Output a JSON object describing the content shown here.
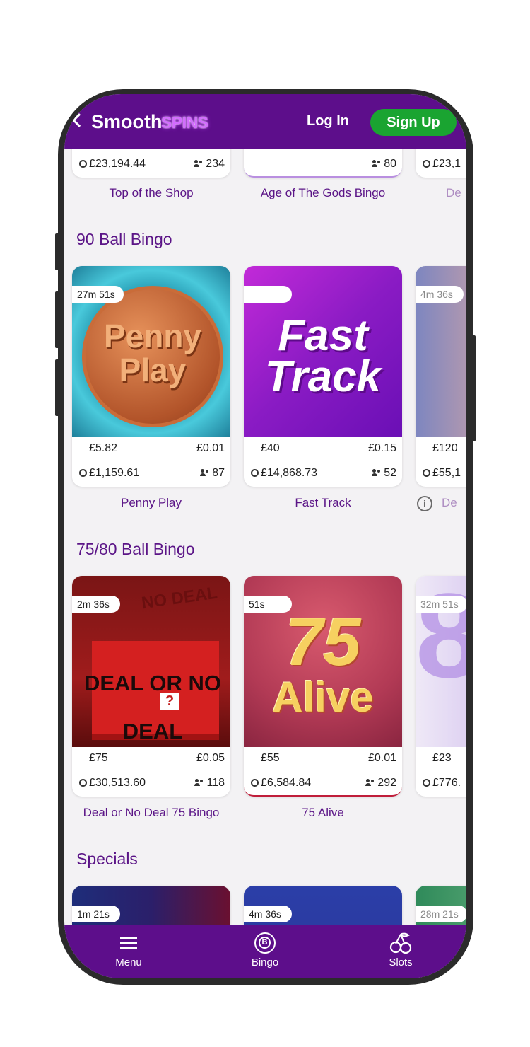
{
  "header": {
    "logo_main": "Smooth",
    "logo_accent": "SPINS",
    "login_label": "Log In",
    "signup_label": "Sign Up"
  },
  "top_row": [
    {
      "name": "Top of the Shop",
      "jackpot": "£23,194.44",
      "players": "234"
    },
    {
      "name": "Age of The Gods Bingo",
      "jackpot": "",
      "players": "80"
    },
    {
      "name": "De",
      "jackpot": "£23,1",
      "players": ""
    }
  ],
  "sections": [
    {
      "title": "90 Ball Bingo",
      "cards": [
        {
          "art_text": "Penny Play",
          "timer": "27m 51s",
          "prize": "£5.82",
          "price": "£0.01",
          "jackpot": "£1,159.61",
          "players": "87",
          "name": "Penny Play"
        },
        {
          "art_text": "Fast Track",
          "timer": "",
          "prize": "£40",
          "price": "£0.15",
          "jackpot": "£14,868.73",
          "players": "52",
          "name": "Fast Track"
        },
        {
          "art_text": "",
          "timer": "4m 36s",
          "prize": "£120",
          "price": "",
          "jackpot": "£55,1",
          "players": "",
          "name": "De"
        }
      ]
    },
    {
      "title": "75/80 Ball Bingo",
      "cards": [
        {
          "art_text": "DEAL OR NO DEAL",
          "art_q": "?",
          "art_bg_text": "NO DEAL",
          "timer": "2m 36s",
          "prize": "£75",
          "price": "£0.05",
          "jackpot": "£30,513.60",
          "players": "118",
          "name": "Deal or No Deal 75 Bingo"
        },
        {
          "art_text_top": "75",
          "art_text_bottom": "Alive",
          "timer": "51s",
          "prize": "£55",
          "price": "£0.01",
          "jackpot": "£6,584.84",
          "players": "292",
          "name": "75 Alive"
        },
        {
          "art_text": "8",
          "timer": "32m 51s",
          "prize": "£23",
          "price": "",
          "jackpot": "£776.",
          "players": "",
          "name": ""
        }
      ]
    },
    {
      "title": "Specials",
      "cards": [
        {
          "timer": "1m 21s"
        },
        {
          "timer": "4m 36s"
        },
        {
          "timer": "28m 21s"
        }
      ]
    }
  ],
  "bottom_nav": [
    {
      "label": "Menu",
      "icon": "menu-icon"
    },
    {
      "label": "Bingo",
      "icon": "bingo-ball-icon",
      "icon_letter": "B"
    },
    {
      "label": "Slots",
      "icon": "cherries-icon"
    }
  ],
  "colors": {
    "brand_purple": "#5d0e8b",
    "signup_green": "#1aa431",
    "title_purple": "#5b1587"
  }
}
